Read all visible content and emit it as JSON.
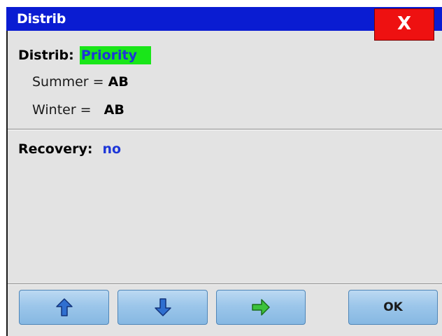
{
  "window": {
    "title": "Distrib",
    "close_label": "X"
  },
  "distrib": {
    "label": "Distrib:",
    "value": "Priority",
    "summer_label": "Summer =",
    "summer_value": "AB",
    "winter_label": "Winter =",
    "winter_value": "AB"
  },
  "recovery": {
    "label": "Recovery:",
    "value": "no"
  },
  "buttons": {
    "up_icon": "arrow-up-icon",
    "down_icon": "arrow-down-icon",
    "next_icon": "arrow-right-icon",
    "ok_label": "OK"
  },
  "colors": {
    "titlebar": "#0a1cd2",
    "close_button": "#ee1111",
    "priority_highlight": "#19e619",
    "value_blue": "#1d36d8",
    "arrow_blue": "#2f6fd0",
    "arrow_green": "#3cc23c"
  }
}
